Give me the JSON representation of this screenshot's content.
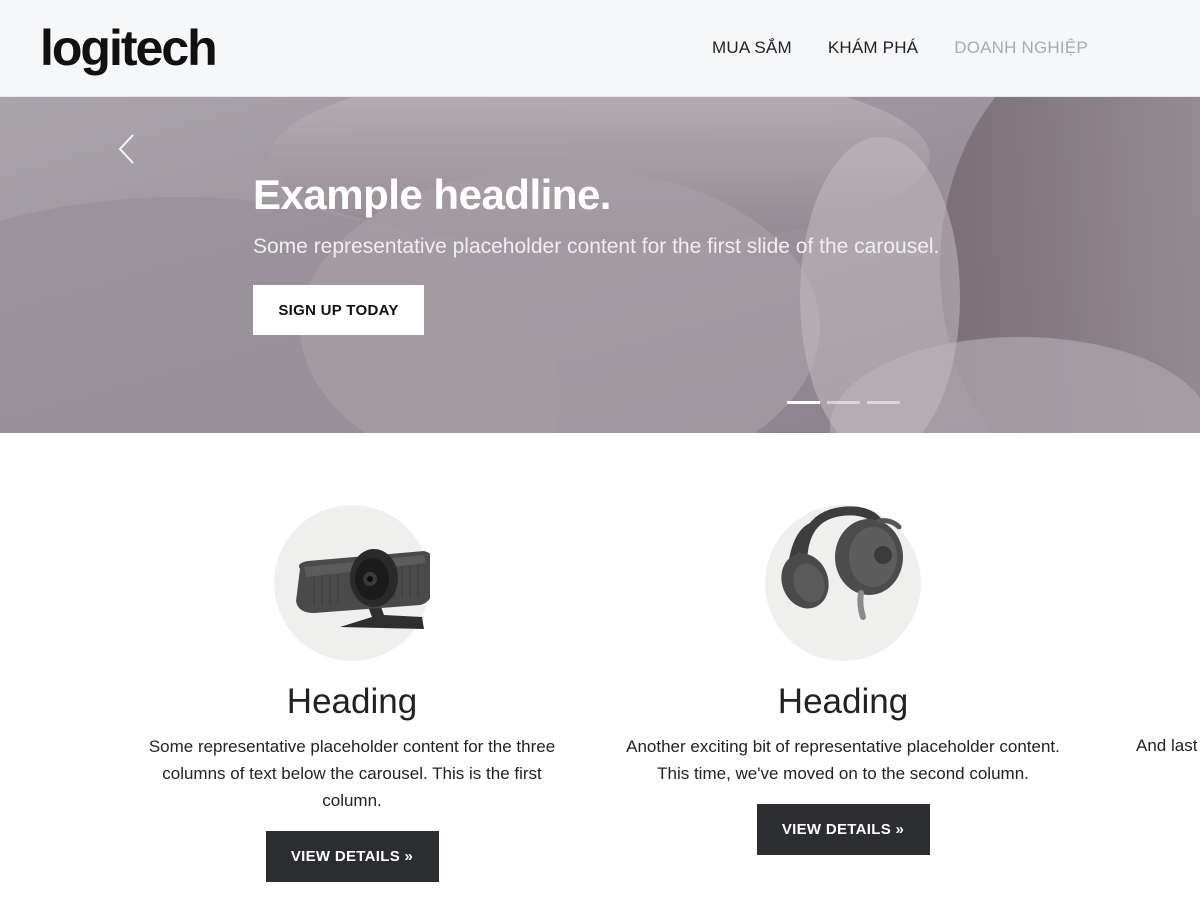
{
  "brand": {
    "logo_text": "logitech"
  },
  "nav": {
    "items": [
      {
        "label": "MUA SẮM"
      },
      {
        "label": "KHÁM PHÁ"
      },
      {
        "label": "DOANH NGHIỆP"
      }
    ]
  },
  "hero": {
    "headline": "Example headline.",
    "text": "Some representative placeholder content for the first slide of the carousel.",
    "button_label": "SIGN UP TODAY",
    "prev_icon": "chevron-left-icon",
    "slide_count": 3,
    "active_slide": 1
  },
  "columns": [
    {
      "image": "webcam-image",
      "heading": "Heading",
      "text": "Some representative placeholder content for the three columns of text below the carousel. This is the first column.",
      "button_label": "VIEW DETAILS »"
    },
    {
      "image": "headset-image",
      "heading": "Heading",
      "text": "Another exciting bit of representative placeholder content. This time, we've moved on to the second column.",
      "button_label": "VIEW DETAILS »"
    },
    {
      "text": "And last"
    }
  ],
  "colors": {
    "header_bg": "#f6f7f9",
    "button_dark": "#2b2d30",
    "nav_muted": "#a9abaf"
  }
}
